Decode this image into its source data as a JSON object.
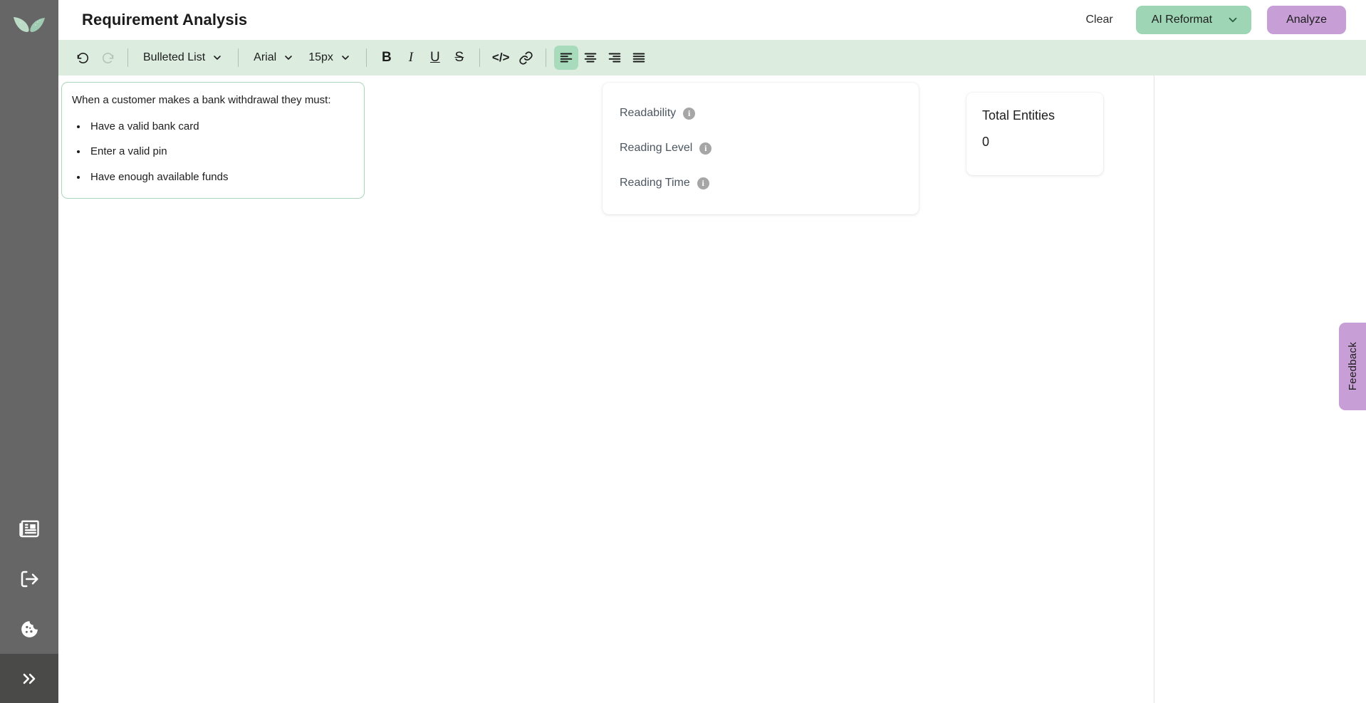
{
  "app": {
    "logo_icon": "leaf-wings-logo",
    "title": "Requirement Analysis"
  },
  "header": {
    "clear_label": "Clear",
    "ai_reformat_label": "AI Reformat",
    "ai_reformat_caret_icon": "chevron-down-icon",
    "analyze_label": "Analyze",
    "ai_reformat_color": "#9ed5b4",
    "analyze_color": "#c79ed6"
  },
  "toolbar": {
    "background_color": "#dcecdf",
    "undo": {
      "icon": "undo-icon",
      "enabled": true
    },
    "redo": {
      "icon": "redo-icon",
      "enabled": false
    },
    "list_style": {
      "value": "Bulleted List",
      "caret_icon": "chevron-down-icon"
    },
    "font_family": {
      "value": "Arial",
      "caret_icon": "chevron-down-icon"
    },
    "font_size": {
      "value": "15px",
      "caret_icon": "chevron-down-icon"
    },
    "bold": {
      "label": "B",
      "icon": "bold-icon"
    },
    "italic": {
      "label": "I",
      "icon": "italic-icon"
    },
    "underline": {
      "label": "U",
      "icon": "underline-icon"
    },
    "strikethrough": {
      "label": "S",
      "icon": "strikethrough-icon"
    },
    "code": {
      "label": "</>",
      "icon": "code-icon"
    },
    "link": {
      "icon": "link-icon"
    },
    "align_left": {
      "icon": "align-left-icon",
      "active": true
    },
    "align_center": {
      "icon": "align-center-icon",
      "active": false
    },
    "align_right": {
      "icon": "align-right-icon",
      "active": false
    },
    "align_justify": {
      "icon": "align-justify-icon",
      "active": false
    },
    "active_highlight_color": "#a8dabc"
  },
  "editor": {
    "border_color": "#a9d6ba",
    "lead_text": "When a customer makes a bank withdrawal they must:",
    "bullets": [
      "Have a valid bank card",
      "Enter a valid pin",
      "Have enough available funds"
    ]
  },
  "metrics": {
    "items": [
      {
        "label": "Readability",
        "info_icon": "info-icon",
        "value": ""
      },
      {
        "label": "Reading Level",
        "info_icon": "info-icon",
        "value": ""
      },
      {
        "label": "Reading Time",
        "info_icon": "info-icon",
        "value": ""
      }
    ]
  },
  "entities": {
    "title": "Total Entities",
    "value": "0"
  },
  "feedback": {
    "label": "Feedback",
    "color": "#c79ed6"
  },
  "sidebar": {
    "background_color": "#666666",
    "items": [
      {
        "name": "news",
        "icon": "newspaper-icon"
      },
      {
        "name": "logout",
        "icon": "logout-icon"
      },
      {
        "name": "cookies",
        "icon": "cookie-icon"
      }
    ],
    "expand": {
      "icon": "double-chevron-right-icon"
    }
  }
}
